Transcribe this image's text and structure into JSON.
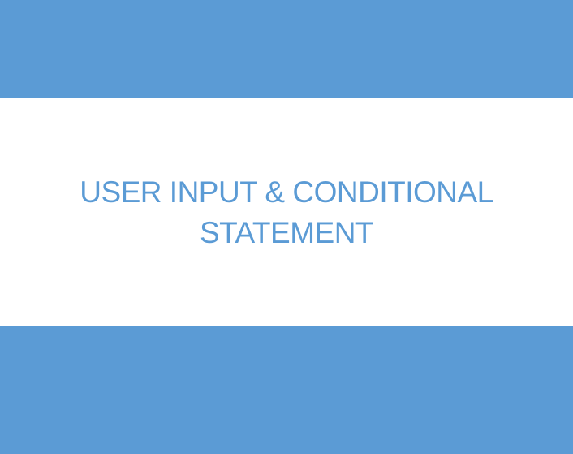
{
  "title": {
    "line1": "USER INPUT & CONDITIONAL",
    "line2": "STATEMENT"
  },
  "colors": {
    "accent": "#5b9bd5",
    "background": "#ffffff"
  }
}
